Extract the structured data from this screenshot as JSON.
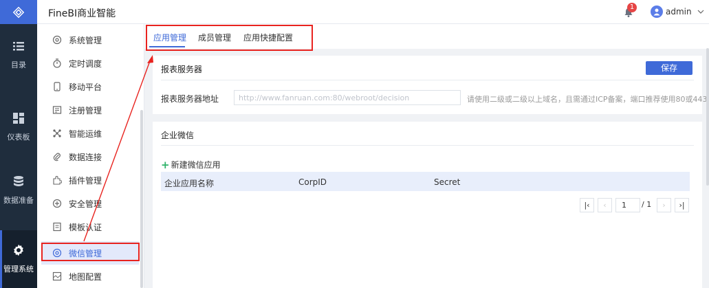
{
  "app": {
    "title": "FineBI商业智能"
  },
  "header": {
    "notification_count": "1",
    "user_name": "admin"
  },
  "rail": {
    "items": [
      {
        "label": "目录",
        "icon": "list-icon"
      },
      {
        "label": "仪表板",
        "icon": "dashboard-icon"
      },
      {
        "label": "数据准备",
        "icon": "database-icon"
      },
      {
        "label": "管理系统",
        "icon": "gear-icon"
      }
    ]
  },
  "subnav": {
    "items": [
      {
        "label": "系统管理",
        "icon": "settings-icon"
      },
      {
        "label": "定时调度",
        "icon": "timer-icon"
      },
      {
        "label": "移动平台",
        "icon": "mobile-icon"
      },
      {
        "label": "注册管理",
        "icon": "register-icon"
      },
      {
        "label": "智能运维",
        "icon": "ops-icon"
      },
      {
        "label": "数据连接",
        "icon": "link-icon"
      },
      {
        "label": "插件管理",
        "icon": "plugin-icon"
      },
      {
        "label": "安全管理",
        "icon": "shield-icon"
      },
      {
        "label": "模板认证",
        "icon": "template-icon"
      },
      {
        "label": "微信管理",
        "icon": "wechat-icon"
      },
      {
        "label": "地图配置",
        "icon": "map-icon"
      }
    ],
    "active_index": 9
  },
  "tabs": [
    {
      "label": "应用管理"
    },
    {
      "label": "成员管理"
    },
    {
      "label": "应用快捷配置"
    }
  ],
  "report_server": {
    "title": "报表服务器",
    "save_label": "保存",
    "field_label": "报表服务器地址",
    "field_placeholder": "http://www.fanruan.com:80/webroot/decision",
    "hint": "请使用二级或二级以上域名，且需通过ICP备案，端口推荐使用80或443"
  },
  "enterprise_wechat": {
    "title": "企业微信",
    "new_app_label": "新建微信应用",
    "columns": [
      "企业应用名称",
      "CorpID",
      "Secret"
    ],
    "rows": []
  },
  "pagination": {
    "current_page": "1",
    "total_pages": "/ 1"
  },
  "colors": {
    "accent": "#3f6ad8",
    "annotation": "#e8231f",
    "rail_bg": "#1f2d3d"
  }
}
